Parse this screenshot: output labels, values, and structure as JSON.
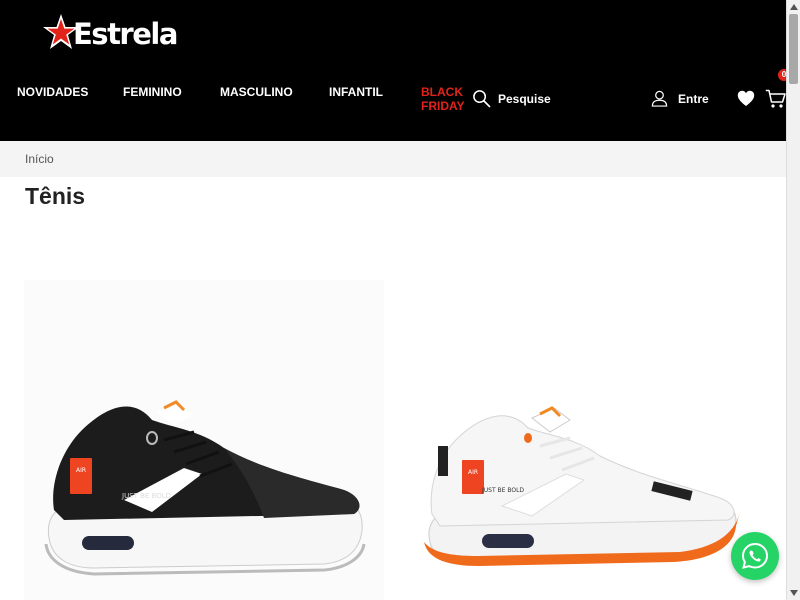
{
  "brand": {
    "name": "Estrela"
  },
  "nav": {
    "items": [
      {
        "label": "NOVIDADES"
      },
      {
        "label": "FEMININO"
      },
      {
        "label": "MASCULINO"
      },
      {
        "label": "INFANTIL"
      }
    ],
    "highlight": {
      "line1": "BLACK",
      "line2": "FRIDAY"
    }
  },
  "search": {
    "label": "Pesquise"
  },
  "account": {
    "label": "Entre"
  },
  "cart": {
    "count": "0"
  },
  "breadcrumb": {
    "home": "Início"
  },
  "page": {
    "title": "Tênis"
  },
  "products": [
    {
      "color": "black",
      "print_a": "AIR",
      "print_b": "JUST BE BOLD"
    },
    {
      "color": "white",
      "print_a": "AIR",
      "print_b": "JUST BE BOLD"
    }
  ],
  "colors": {
    "header_bg": "#000000",
    "accent_red": "#e2231a",
    "whatsapp_green": "#25d366"
  },
  "icons": [
    "star-logo-icon",
    "search-icon",
    "user-icon",
    "heart-icon",
    "cart-icon",
    "whatsapp-icon"
  ]
}
